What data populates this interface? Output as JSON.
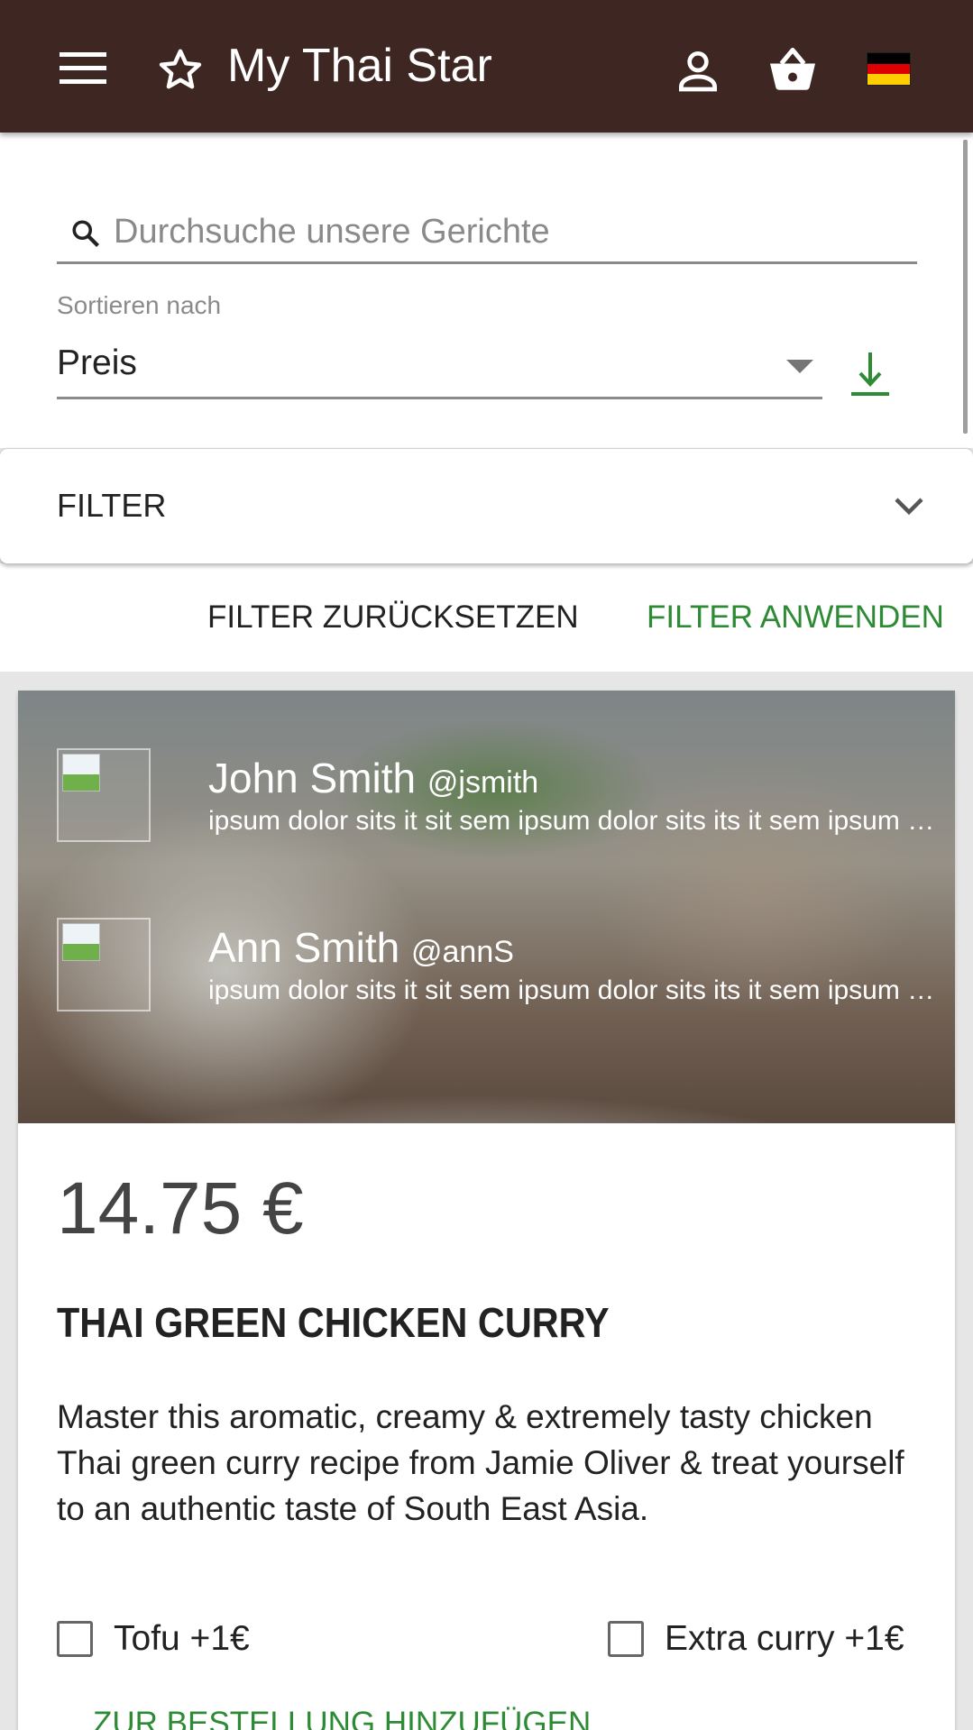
{
  "app": {
    "title": "My Thai Star",
    "brand_color": "#3e2723",
    "accent_color": "#2e8b35"
  },
  "toolbar": {
    "icons": [
      "menu-icon",
      "star-icon",
      "account-icon",
      "basket-icon",
      "german-flag-icon"
    ]
  },
  "search": {
    "placeholder": "Durchsuche unsere Gerichte",
    "value": ""
  },
  "sort": {
    "label": "Sortieren nach",
    "selected": "Preis",
    "direction_icon": "sort-direction-icon"
  },
  "filter": {
    "title": "FILTER",
    "reset_label": "FILTER ZURÜCKSETZEN",
    "apply_label": "FILTER ANWENDEN"
  },
  "dish": {
    "reviews": [
      {
        "name": "John Smith",
        "handle": "@jsmith",
        "text": "ipsum dolor sits it sit sem ipsum dolor sits its it sem ipsum dolor sits"
      },
      {
        "name": "Ann Smith",
        "handle": "@annS",
        "text": "ipsum dolor sits it sit sem ipsum dolor sits its it sem ipsum dolor sits"
      }
    ],
    "price": "14.75 €",
    "name": "THAI GREEN CHICKEN CURRY",
    "description": "Master this aromatic, creamy & extremely tasty chicken Thai green curry recipe from Jamie Oliver & treat yourself to an authentic taste of South East Asia.",
    "extras": [
      {
        "label": "Tofu +1€",
        "checked": false
      },
      {
        "label": "Extra curry +1€",
        "checked": false
      }
    ],
    "add_to_order_label": "ZUR BESTELLUNG HINZUFÜGEN"
  }
}
